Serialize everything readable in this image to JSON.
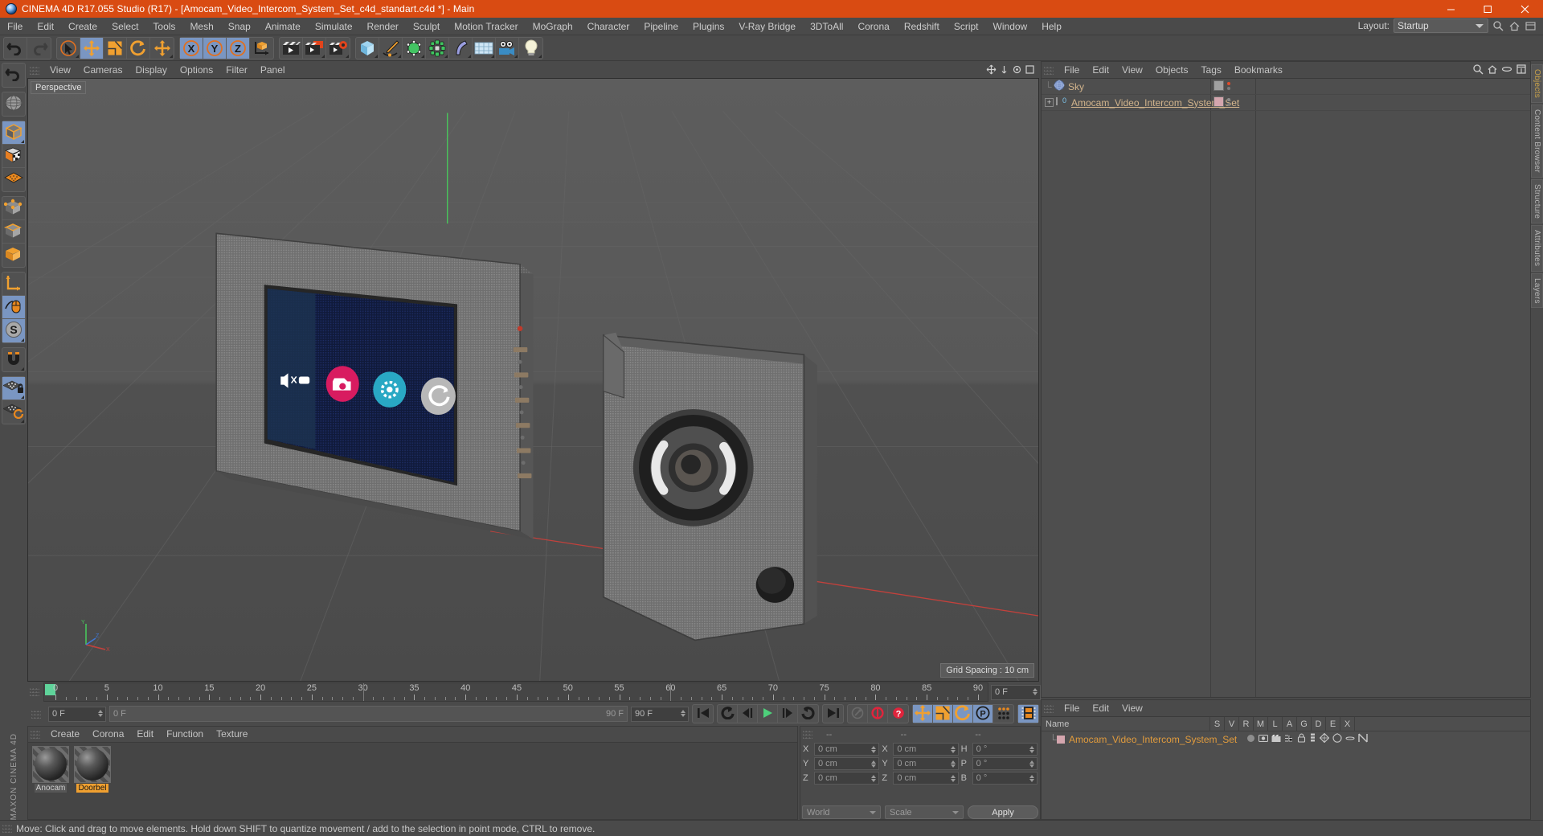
{
  "window": {
    "title": "CINEMA 4D R17.055 Studio (R17) - [Amocam_Video_Intercom_System_Set_c4d_standart.c4d *] - Main",
    "app_icon": "c4d-logo-icon",
    "minimize": "minimize-icon",
    "maximize": "maximize-icon",
    "close": "close-icon",
    "accent_color": "#d94b12",
    "bg_color": "#4a4a4a"
  },
  "menubar": {
    "items": [
      "File",
      "Edit",
      "Create",
      "Select",
      "Tools",
      "Mesh",
      "Snap",
      "Animate",
      "Simulate",
      "Render",
      "Sculpt",
      "Motion Tracker",
      "MoGraph",
      "Character",
      "Pipeline",
      "Plugins",
      "V-Ray Bridge",
      "3DToAll",
      "Corona",
      "Redshift",
      "Script",
      "Window",
      "Help"
    ],
    "layout_label": "Layout:",
    "layout_value": "Startup",
    "right_icons": [
      "search-icon",
      "home-icon",
      "layout-preset-icon"
    ]
  },
  "toolbar": {
    "groups": [
      {
        "name": "undo-redo",
        "buttons": [
          {
            "name": "undo-button",
            "icon": "undo-arrow-icon",
            "selected": false,
            "corner": false
          },
          {
            "name": "redo-button",
            "icon": "redo-arrow-icon",
            "selected": false,
            "corner": false
          }
        ]
      },
      {
        "name": "transform-tools",
        "buttons": [
          {
            "name": "live-selection-tool",
            "icon": "cursor-circle-icon",
            "selected": false,
            "corner": true
          },
          {
            "name": "move-tool",
            "icon": "move-arrows-icon",
            "selected": true,
            "corner": false
          },
          {
            "name": "scale-tool",
            "icon": "scale-box-icon",
            "selected": false,
            "corner": false
          },
          {
            "name": "rotate-tool",
            "icon": "rotate-arc-icon",
            "selected": false,
            "corner": false
          },
          {
            "name": "transform-tool",
            "icon": "move-arrows-icon",
            "selected": false,
            "corner": true
          }
        ]
      },
      {
        "name": "axis-locks",
        "buttons": [
          {
            "name": "lock-x-axis",
            "icon": "x-axis-icon",
            "selected": true,
            "corner": false
          },
          {
            "name": "lock-y-axis",
            "icon": "y-axis-icon",
            "selected": true,
            "corner": false
          },
          {
            "name": "lock-z-axis",
            "icon": "z-axis-icon",
            "selected": true,
            "corner": false
          },
          {
            "name": "world-object-coordinate-toggle",
            "icon": "world-axis-cube-icon",
            "selected": false,
            "corner": false
          }
        ]
      },
      {
        "name": "render-group",
        "buttons": [
          {
            "name": "render-view-button",
            "icon": "render-clapper-icon",
            "selected": false,
            "corner": false
          },
          {
            "name": "render-to-picture-viewer-button",
            "icon": "render-picture-icon",
            "selected": false,
            "corner": true
          },
          {
            "name": "edit-render-settings-button",
            "icon": "render-settings-icon",
            "selected": false,
            "corner": true
          }
        ]
      },
      {
        "name": "create-group",
        "buttons": [
          {
            "name": "add-cube-object-button",
            "icon": "cube-primitive-icon",
            "selected": false,
            "corner": true
          },
          {
            "name": "add-spline-button",
            "icon": "pen-spline-icon",
            "selected": false,
            "corner": true
          },
          {
            "name": "add-generator-button",
            "icon": "nurbs-generator-icon",
            "selected": false,
            "corner": true
          },
          {
            "name": "add-mograph-button",
            "icon": "mograph-cloner-icon",
            "selected": false,
            "corner": true
          },
          {
            "name": "add-deformer-button",
            "icon": "bend-deformer-icon",
            "selected": false,
            "corner": true
          },
          {
            "name": "add-environment-button",
            "icon": "floor-environment-icon",
            "selected": false,
            "corner": true
          },
          {
            "name": "add-camera-button",
            "icon": "camera-icon",
            "selected": false,
            "corner": true
          },
          {
            "name": "add-light-button",
            "icon": "light-bulb-icon",
            "selected": false,
            "corner": true
          }
        ]
      }
    ]
  },
  "left_palette": {
    "groups": [
      {
        "name": "undo-group",
        "buttons": [
          {
            "name": "undo-view-button",
            "icon": "undo-arrow-icon",
            "selected": false,
            "corner": false
          }
        ]
      },
      {
        "name": "world-group",
        "buttons": [
          {
            "name": "world-coordinates-button",
            "icon": "globe-wire-icon",
            "selected": false,
            "corner": false
          }
        ]
      },
      {
        "name": "editmode-group",
        "buttons": [
          {
            "name": "make-editable-button",
            "icon": "editable-cube-icon",
            "selected": true,
            "corner": true
          },
          {
            "name": "texture-mode-button",
            "icon": "checker-cube-icon",
            "selected": false,
            "corner": false
          },
          {
            "name": "viewport-solo-button",
            "icon": "orange-grid-icon",
            "selected": false,
            "corner": false
          }
        ]
      },
      {
        "name": "component-group",
        "buttons": [
          {
            "name": "points-mode-button",
            "icon": "points-cube-icon",
            "selected": false,
            "corner": false
          },
          {
            "name": "edges-mode-button",
            "icon": "edges-cube-icon",
            "selected": false,
            "corner": false
          },
          {
            "name": "polygons-mode-button",
            "icon": "polygons-cube-icon",
            "selected": false,
            "corner": false
          }
        ]
      },
      {
        "name": "axis-group",
        "buttons": [
          {
            "name": "enable-axis-modification-button",
            "icon": "axis-l-icon",
            "selected": false,
            "corner": false
          },
          {
            "name": "viewport-solo-single-button",
            "icon": "mouse-icon",
            "selected": true,
            "corner": false
          },
          {
            "name": "enable-snap-button",
            "icon": "s-circle-icon",
            "selected": true,
            "corner": true
          }
        ]
      },
      {
        "name": "snap-group",
        "buttons": [
          {
            "name": "magnet-tool-button",
            "icon": "magnet-icon",
            "selected": false,
            "corner": true
          }
        ]
      },
      {
        "name": "lock-group",
        "buttons": [
          {
            "name": "workplane-lock-button",
            "icon": "grid-lock-icon",
            "selected": true,
            "corner": true
          },
          {
            "name": "workplane-rotate-button",
            "icon": "grid-rotate-icon",
            "selected": false,
            "corner": true
          }
        ]
      }
    ],
    "brand": "MAXON CINEMA 4D"
  },
  "viewport": {
    "menu": [
      "View",
      "Cameras",
      "Display",
      "Options",
      "Filter",
      "Panel"
    ],
    "view_name": "Perspective",
    "grid_spacing": "Grid Spacing : 10 cm",
    "panel_icons": [
      "viewport-move-icon",
      "viewport-scale-icon",
      "viewport-rotate-icon",
      "viewport-maximize-icon"
    ],
    "scene": {
      "objects": [
        "intercom-monitor",
        "doorbell-unit"
      ],
      "screen_buttons": [
        {
          "name": "screen-icon-mute",
          "color": "#ffffff"
        },
        {
          "name": "screen-icon-record",
          "color": "#d81b60"
        },
        {
          "name": "screen-icon-settings",
          "color": "#29a8c4"
        },
        {
          "name": "screen-icon-refresh",
          "color": "#b8b8b8"
        }
      ]
    }
  },
  "timeline": {
    "ticks": [
      0,
      5,
      10,
      15,
      20,
      25,
      30,
      35,
      40,
      45,
      50,
      55,
      60,
      65,
      70,
      75,
      80,
      85,
      90
    ],
    "start_frame": "0 F",
    "end_frame": "90 F",
    "current_frame": "0 F",
    "range_start": "0 F",
    "range_end": "90 F",
    "preview_min": "0 F",
    "preview_max": "90 F"
  },
  "playback": {
    "buttons": [
      {
        "name": "go-to-start-button",
        "icon": "skip-start-icon",
        "selected": false
      },
      {
        "name": "go-to-previous-key-button",
        "icon": "prev-key-icon",
        "selected": false
      },
      {
        "name": "step-back-button",
        "icon": "step-back-icon",
        "selected": false
      },
      {
        "name": "play-button",
        "icon": "play-icon",
        "selected": false
      },
      {
        "name": "step-forward-button",
        "icon": "step-forward-icon",
        "selected": false
      },
      {
        "name": "go-to-next-key-button",
        "icon": "next-key-icon",
        "selected": false
      },
      {
        "name": "go-to-end-button",
        "icon": "skip-end-icon",
        "selected": false
      }
    ],
    "record_buttons": [
      {
        "name": "autokeying-button",
        "icon": "key-icon",
        "selected": false
      },
      {
        "name": "record-active-objects-button",
        "icon": "record-circle-icon",
        "selected": false
      },
      {
        "name": "auto-keyframing-button",
        "icon": "question-record-icon",
        "selected": false
      }
    ],
    "key_toggles": [
      {
        "name": "position-key-toggle",
        "icon": "move-arrows-icon",
        "selected": true
      },
      {
        "name": "scale-key-toggle",
        "icon": "scale-box-icon",
        "selected": true
      },
      {
        "name": "rotation-key-toggle",
        "icon": "rotate-arc-icon",
        "selected": true
      },
      {
        "name": "parameter-key-toggle",
        "icon": "p-circle-icon",
        "selected": true
      },
      {
        "name": "point-level-animation-toggle",
        "icon": "pla-dots-icon",
        "selected": false
      }
    ],
    "extra": [
      {
        "name": "timeline-window-button",
        "icon": "filmstrip-icon",
        "selected": true
      }
    ]
  },
  "material_manager": {
    "menu": [
      "Create",
      "Corona",
      "Edit",
      "Function",
      "Texture"
    ],
    "materials": [
      {
        "name": "Anocam",
        "selected": false
      },
      {
        "name": "Doorbel",
        "selected": true
      }
    ]
  },
  "coordinates": {
    "headers": [
      "--",
      "--",
      "--"
    ],
    "rows": [
      {
        "pos_label": "X",
        "pos_value": "0 cm",
        "size_label": "X",
        "size_value": "0 cm",
        "rot_label": "H",
        "rot_value": "0 °"
      },
      {
        "pos_label": "Y",
        "pos_value": "0 cm",
        "size_label": "Y",
        "size_value": "0 cm",
        "rot_label": "P",
        "rot_value": "0 °"
      },
      {
        "pos_label": "Z",
        "pos_value": "0 cm",
        "size_label": "Z",
        "size_value": "0 cm",
        "rot_label": "B",
        "rot_value": "0 °"
      }
    ],
    "system": "World",
    "mode": "Scale",
    "apply_label": "Apply"
  },
  "object_manager": {
    "menu": [
      "File",
      "Edit",
      "View",
      "Objects",
      "Tags",
      "Bookmarks"
    ],
    "right_icons": [
      "search-icon",
      "home-icon",
      "ellipse-icon",
      "fit-icon"
    ],
    "items": [
      {
        "name": "Sky",
        "icon": "sky-sphere-icon",
        "expandable": false,
        "tag_swatch": "#a0a0a0",
        "tag_type": "sky-tag",
        "dot_color": "#e04b2a"
      },
      {
        "name": "Amocam_Video_Intercom_System_Set",
        "icon": "null-object-icon",
        "expandable": true,
        "tag_swatch": "#d4a6ae",
        "tag_type": "material-tag",
        "dot_color": "#8a8a8a"
      }
    ]
  },
  "attribute_layers": {
    "menu": [
      "File",
      "Edit",
      "View"
    ],
    "columns": [
      "Name",
      "S",
      "V",
      "R",
      "M",
      "L",
      "A",
      "G",
      "D",
      "E",
      "X"
    ],
    "rows": [
      {
        "name": "Amocam_Video_Intercom_System_Set",
        "swatch": "#d4a6ae",
        "icons": [
          "solo-dot-icon",
          "visible-icon",
          "render-icon",
          "manager-icon",
          "lock-icon",
          "animation-icon",
          "generator-icon",
          "deformer-icon",
          "expression-icon",
          "xref-icon"
        ]
      }
    ]
  },
  "side_tabs": [
    {
      "label": "Objects",
      "active": true
    },
    {
      "label": "Content Browser",
      "active": false
    },
    {
      "label": "Structure",
      "active": false
    },
    {
      "label": "Attributes",
      "active": false
    },
    {
      "label": "Layers",
      "active": false
    }
  ],
  "statusbar": {
    "message": "Move: Click and drag to move elements. Hold down SHIFT to quantize movement / add to the selection in point mode, CTRL to remove."
  }
}
